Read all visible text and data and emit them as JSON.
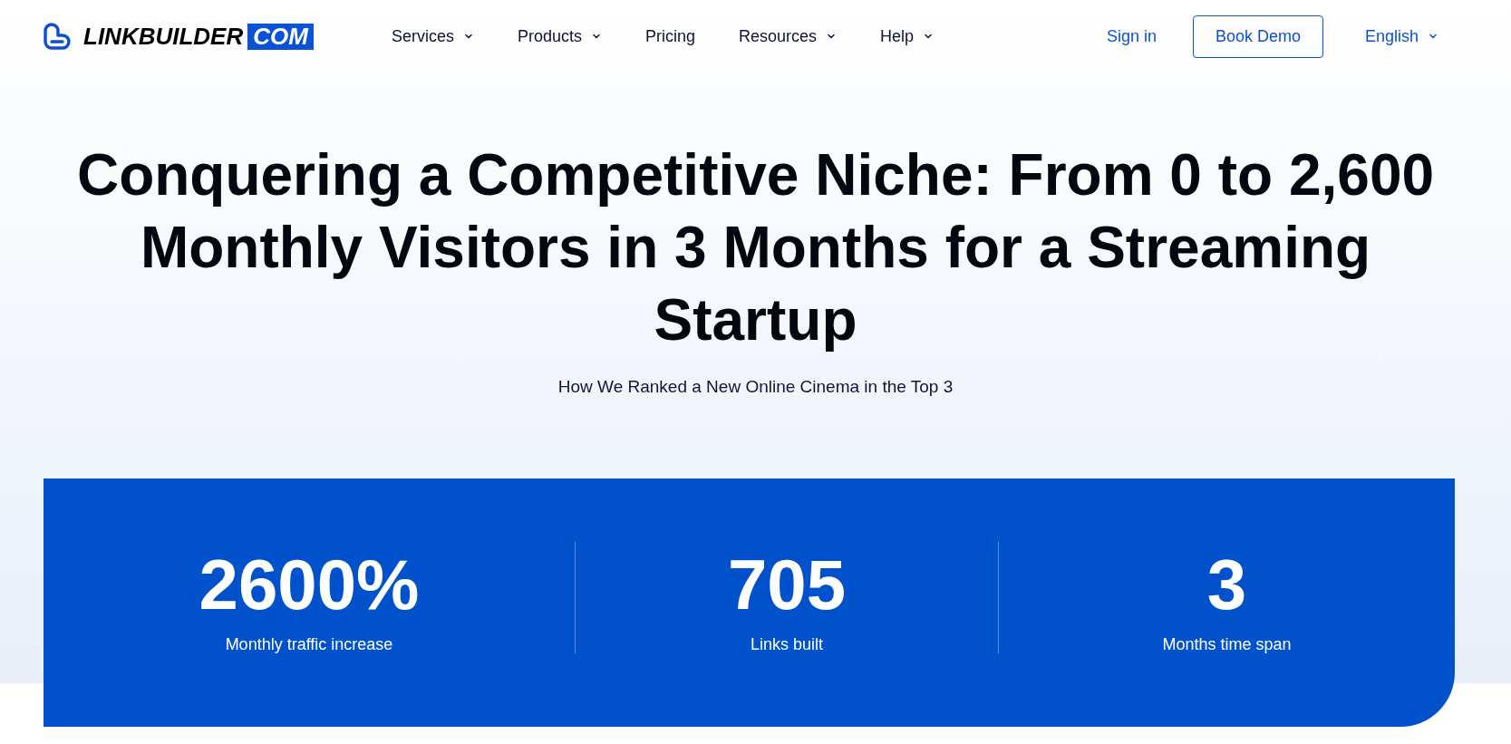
{
  "header": {
    "logo": {
      "wordmark": "LINKBUILDER",
      "tag": "COM"
    },
    "nav": [
      {
        "label": "Services",
        "dropdown": true
      },
      {
        "label": "Products",
        "dropdown": true
      },
      {
        "label": "Pricing",
        "dropdown": false
      },
      {
        "label": "Resources",
        "dropdown": true
      },
      {
        "label": "Help",
        "dropdown": true
      }
    ],
    "sign_in": "Sign in",
    "cta": "Book Demo",
    "language": "English"
  },
  "hero": {
    "title": "Conquering a Competitive Niche: From 0 to 2,600 Monthly Visitors in 3 Months for a Streaming Startup",
    "subtitle": "How We Ranked a New Online Cinema in the Top 3"
  },
  "stats": [
    {
      "value": "2600%",
      "label": "Monthly traffic increase"
    },
    {
      "value": "705",
      "label": "Links built"
    },
    {
      "value": "3",
      "label": "Months time span"
    }
  ]
}
